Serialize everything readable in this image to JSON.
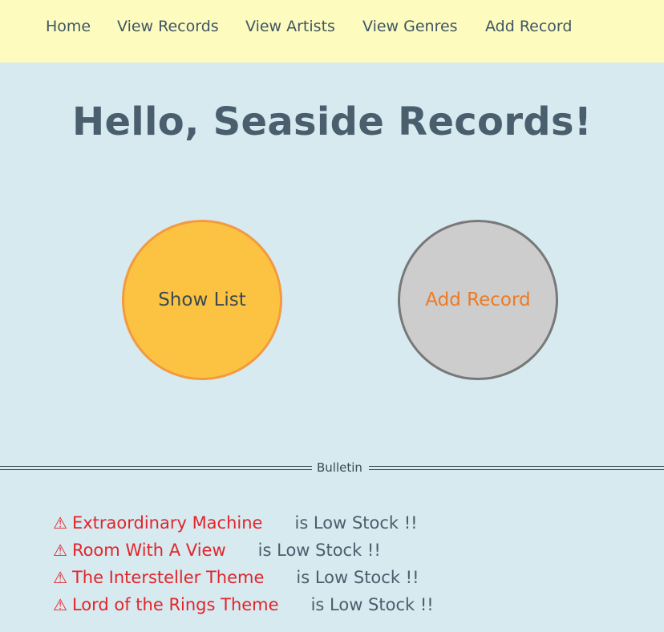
{
  "nav": {
    "items": [
      {
        "label": "Home"
      },
      {
        "label": "View Records"
      },
      {
        "label": "View Artists"
      },
      {
        "label": "View Genres"
      },
      {
        "label": "Add Record"
      }
    ]
  },
  "main": {
    "title": "Hello, Seaside Records!",
    "show_list_label": "Show List",
    "add_record_label": "Add Record"
  },
  "bulletin": {
    "label": "Bulletin",
    "warning_icon": "⚠",
    "items": [
      {
        "name": "Extraordinary Machine",
        "status": "is Low Stock !!"
      },
      {
        "name": "Room With A View",
        "status": "is Low Stock !!"
      },
      {
        "name": "The Intersteller Theme",
        "status": "is Low Stock !!"
      },
      {
        "name": "Lord of the Rings Theme",
        "status": "is Low Stock !!"
      }
    ]
  },
  "colors": {
    "nav_bg": "#fdfbbd",
    "page_bg": "#d6eaf0",
    "show_list_fill": "#fcc343",
    "add_record_fill": "#cdcdcd",
    "warning": "#e3242b",
    "accent_orange": "#ee7a22"
  }
}
